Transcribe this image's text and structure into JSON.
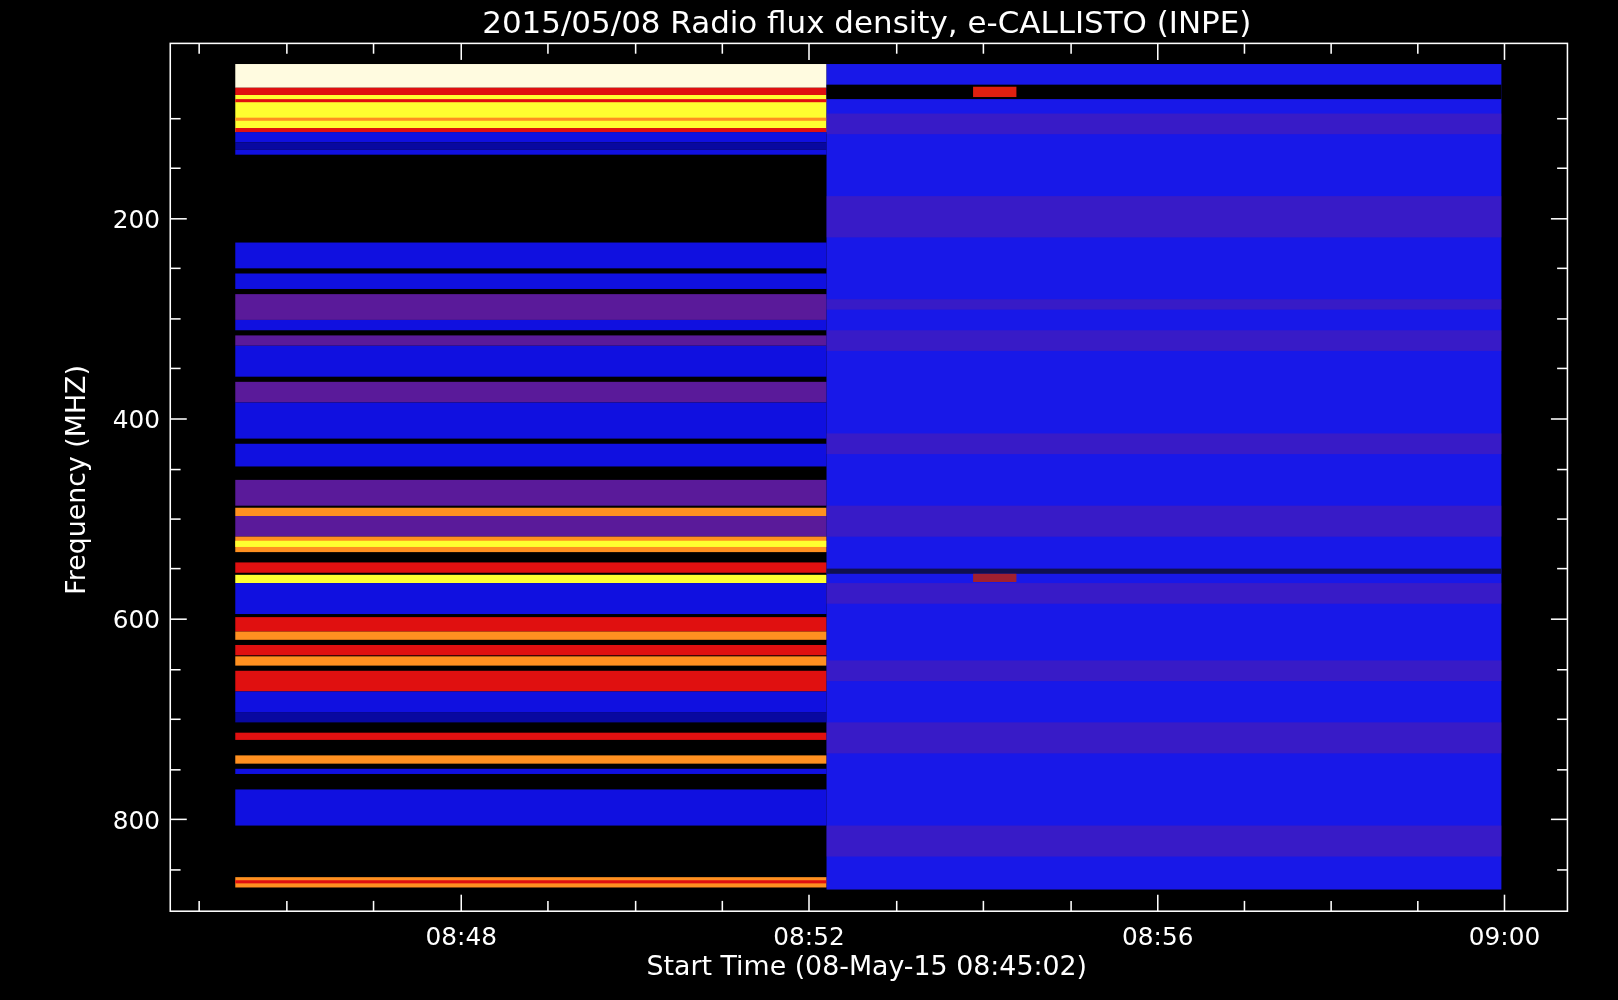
{
  "title": "2015/05/08  Radio flux density, e-CALLISTO (INPE)",
  "y_axis": {
    "label": "Frequency (MHZ)",
    "ticks": [
      "200",
      "400",
      "600",
      "800"
    ]
  },
  "x_axis": {
    "label": "Start Time (08-May-15 08:45:02)",
    "ticks": [
      "08:48",
      "08:52",
      "08:56",
      "09:00"
    ]
  }
}
